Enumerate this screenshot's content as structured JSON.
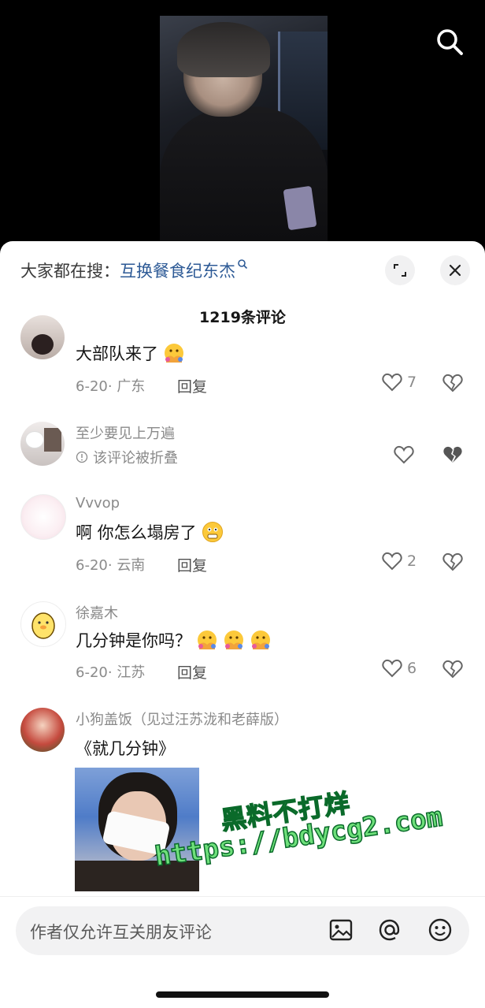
{
  "header": {
    "hot_search_prefix": "大家都在搜：",
    "hot_search_keyword": "互换餐食纪东杰",
    "comment_count": "1219条评论"
  },
  "comments": [
    {
      "username": "",
      "text": "大部队来了",
      "date": "6-20",
      "location": "广东",
      "reply_label": "回复",
      "likes": "7"
    },
    {
      "username": "至少要见上万遍",
      "folded_text": "该评论被折叠"
    },
    {
      "username": "Vvvop",
      "text": "啊 你怎么塌房了",
      "date": "6-20",
      "location": "云南",
      "reply_label": "回复",
      "likes": "2"
    },
    {
      "username": "徐嘉木",
      "text": "几分钟是你吗？",
      "date": "6-20",
      "location": "江苏",
      "reply_label": "回复",
      "likes": "6"
    },
    {
      "username": "小狗盖饭（见过汪苏泷和老薛版）",
      "text": "《就几分钟》"
    }
  ],
  "watermark": {
    "line1": "黑料不打烊",
    "line2": "https://bdycg2.com"
  },
  "input": {
    "placeholder": "作者仅允许互关朋友评论"
  },
  "icons": [
    "search-icon",
    "expand-icon",
    "close-icon",
    "heart-icon",
    "broken-heart-icon",
    "image-icon",
    "at-icon",
    "emoji-icon"
  ]
}
